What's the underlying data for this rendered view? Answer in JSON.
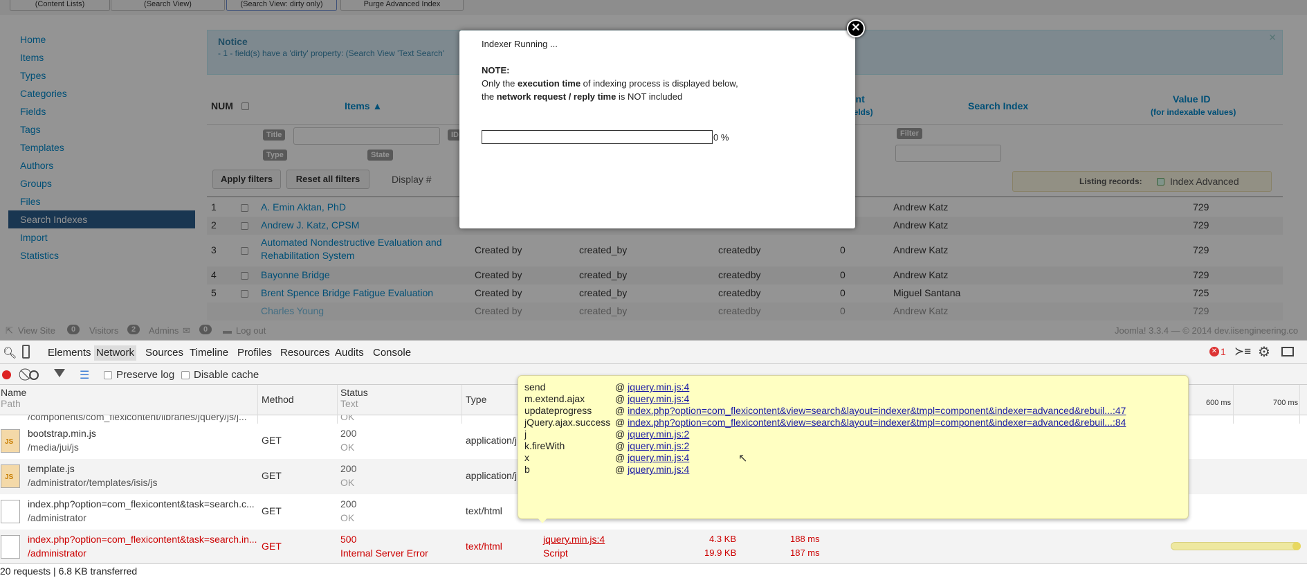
{
  "top_buttons": [
    "(Content Lists)",
    "(Search View)",
    "(Search View: dirty only)",
    "Purge Advanced Index"
  ],
  "sidebar": {
    "items": [
      {
        "label": "Home"
      },
      {
        "label": "Items"
      },
      {
        "label": "Types"
      },
      {
        "label": "Categories"
      },
      {
        "label": "Fields"
      },
      {
        "label": "Tags"
      },
      {
        "label": "Templates"
      },
      {
        "label": "Authors"
      },
      {
        "label": "Groups"
      },
      {
        "label": "Files"
      },
      {
        "label": "Search Indexes",
        "active": true
      },
      {
        "label": "Import"
      },
      {
        "label": "Statistics"
      }
    ]
  },
  "notice": {
    "title": "Notice",
    "message": "- 1 - field(s) have a 'dirty' property: (Search View 'Text Search'"
  },
  "grid": {
    "headers": {
      "num": "NUM",
      "items": "Items ▲",
      "count": "unt",
      "count_sub": "le fields)",
      "search_index": "Search Index",
      "value_id": "Value ID",
      "value_id_sub": "(for indexable values)"
    },
    "filters": {
      "title": "Title",
      "id": "ID",
      "type": "Type",
      "state": "State",
      "filter": "Filter"
    },
    "buttons": {
      "apply": "Apply filters",
      "reset": "Reset all filters",
      "display": "Display #"
    },
    "listing": {
      "label": "Listing records:",
      "value": "Index Advanced"
    },
    "rows": [
      {
        "num": "1",
        "title": "A. Emin Aktan, PhD",
        "created": "",
        "field": "",
        "index": "",
        "count": "",
        "author": "Andrew Katz",
        "value_id": "729"
      },
      {
        "num": "2",
        "title": "Andrew J. Katz, CPSM",
        "created": "",
        "field": "",
        "index": "",
        "count": "",
        "author": "Andrew Katz",
        "value_id": "729"
      },
      {
        "num": "3",
        "title": "Automated Nondestructive Evaluation and",
        "title2": "Rehabilitation System",
        "created": "Created by",
        "field": "created_by",
        "index": "createdby",
        "count": "0",
        "author": "Andrew Katz",
        "value_id": "729"
      },
      {
        "num": "4",
        "title": "Bayonne Bridge",
        "created": "Created by",
        "field": "created_by",
        "index": "createdby",
        "count": "0",
        "author": "Andrew Katz",
        "value_id": "729"
      },
      {
        "num": "5",
        "title": "Brent Spence Bridge Fatigue Evaluation",
        "created": "Created by",
        "field": "created_by",
        "index": "createdby",
        "count": "0",
        "author": "Miguel Santana",
        "value_id": "725"
      },
      {
        "num": "",
        "title": "Charles Young",
        "created": "Created by",
        "field": "created_by",
        "index": "createdby",
        "count": "0",
        "author": "Andrew Katz",
        "value_id": "729"
      }
    ]
  },
  "modal": {
    "title": "Indexer Running ...",
    "note_label": "NOTE:",
    "line1_pre": "Only the ",
    "line1_bold": "execution time",
    "line1_post": " of indexing process is displayed below,",
    "line2_pre": "the ",
    "line2_bold": "network request / reply time",
    "line2_post": " is NOT included",
    "progress_text": "0 %",
    "progress_value": 0
  },
  "statusbar": {
    "view_site": "View Site",
    "visitors_count": "0",
    "visitors": "Visitors",
    "admins_count": "2",
    "admins": "Admins",
    "messages_count": "0",
    "logout": "Log out",
    "version": "Joomla! 3.3.4 — © 2014 dev.iisengineering.co"
  },
  "devtools": {
    "tabs": [
      "Elements",
      "Network",
      "Sources",
      "Timeline",
      "Profiles",
      "Resources",
      "Audits",
      "Console"
    ],
    "active_tab": "Network",
    "error_count": "1",
    "preserve_log": "Preserve log",
    "disable_cache": "Disable cache",
    "columns": {
      "name": "Name",
      "path": "Path",
      "method": "Method",
      "status": "Status",
      "text": "Text",
      "type": "Type"
    },
    "timeline_ticks": [
      "600 ms",
      "700 ms"
    ],
    "partial_path": "/components/com_flexicontent/libraries/jquery/js/j...",
    "partial_status": "OK",
    "requests": [
      {
        "name": "bootstrap.min.js",
        "path": "/media/jui/js",
        "method": "GET",
        "status": "200",
        "status_text": "OK",
        "type": "application/j",
        "icon": "js-file-icon"
      },
      {
        "name": "template.js",
        "path": "/administrator/templates/isis/js",
        "method": "GET",
        "status": "200",
        "status_text": "OK",
        "type": "application/j",
        "icon": "js-file-icon"
      },
      {
        "name": "index.php?option=com_flexicontent&task=search.c...",
        "path": "/administrator",
        "method": "GET",
        "status": "200",
        "status_text": "OK",
        "type": "text/html",
        "icon": "doc-file-icon"
      },
      {
        "name": "index.php?option=com_flexicontent&task=search.in...",
        "path": "/administrator",
        "method": "GET",
        "status": "500",
        "status_text": "Internal Server Error",
        "type": "text/html",
        "initiator": "jquery.min.js:4",
        "initiator_type": "Script",
        "size": "4.3 KB",
        "content": "19.9 KB",
        "time": "188 ms",
        "latency": "187 ms",
        "error": true,
        "icon": "doc-file-icon"
      }
    ],
    "footer": "20 requests | 6.8 KB transferred",
    "stack": [
      {
        "fn": "send",
        "link": "jquery.min.js:4"
      },
      {
        "fn": "m.extend.ajax",
        "link": "jquery.min.js:4"
      },
      {
        "fn": "updateprogress",
        "link": "index.php?option=com_flexicontent&view=search&layout=indexer&tmpl=component&indexer=advanced&rebuil...:47"
      },
      {
        "fn": "jQuery.ajax.success",
        "link": "index.php?option=com_flexicontent&view=search&layout=indexer&tmpl=component&indexer=advanced&rebuil...:84"
      },
      {
        "fn": "j",
        "link": "jquery.min.js:2"
      },
      {
        "fn": "k.fireWith",
        "link": "jquery.min.js:2"
      },
      {
        "fn": "x",
        "link": "jquery.min.js:4"
      },
      {
        "fn": "b",
        "link": "jquery.min.js:4"
      }
    ],
    "stack_at": "@"
  }
}
